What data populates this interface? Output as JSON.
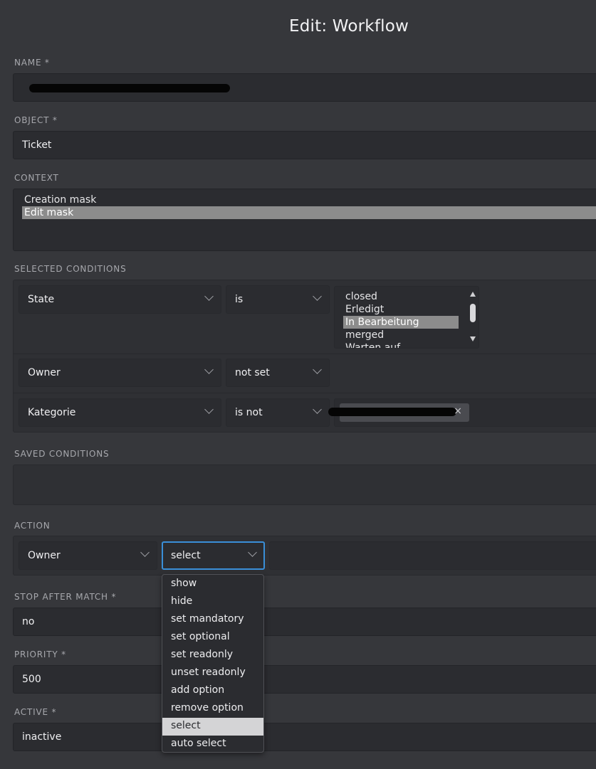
{
  "page": {
    "title": "Edit: Workflow"
  },
  "name": {
    "label": "NAME *",
    "value": ""
  },
  "object": {
    "label": "OBJECT *",
    "value": "Ticket"
  },
  "context": {
    "label": "CONTEXT",
    "options": [
      "Creation mask",
      "Edit mask"
    ],
    "selected": "Edit mask"
  },
  "selected_conditions": {
    "label": "SELECTED CONDITIONS",
    "rows": [
      {
        "attribute": "State",
        "operator": "is",
        "values": [
          "closed",
          "Erledigt",
          "In Bearbeitung",
          "merged",
          "Warten auf Rückmeldung"
        ],
        "selected_value": "In Bearbeitung"
      },
      {
        "attribute": "Owner",
        "operator": "not set"
      },
      {
        "attribute": "Kategorie",
        "operator": "is not",
        "token_remove": "×"
      }
    ]
  },
  "saved_conditions": {
    "label": "SAVED CONDITIONS"
  },
  "action": {
    "label": "ACTION",
    "attribute": "Owner",
    "operation": "select",
    "dropdown_options": [
      "show",
      "hide",
      "set mandatory",
      "set optional",
      "set readonly",
      "unset readonly",
      "add option",
      "remove option",
      "select",
      "auto select"
    ],
    "highlighted": "select"
  },
  "stop_after_match": {
    "label": "STOP AFTER MATCH *",
    "value": "no"
  },
  "priority": {
    "label": "PRIORITY *",
    "value": "500"
  },
  "active": {
    "label": "ACTIVE *",
    "value": "inactive"
  },
  "colors": {
    "background": "#36373b",
    "field": "#2b2c30",
    "focus": "#3a8fd8",
    "selection": "#8c8c8c",
    "highlight": "#d4d4d6"
  }
}
